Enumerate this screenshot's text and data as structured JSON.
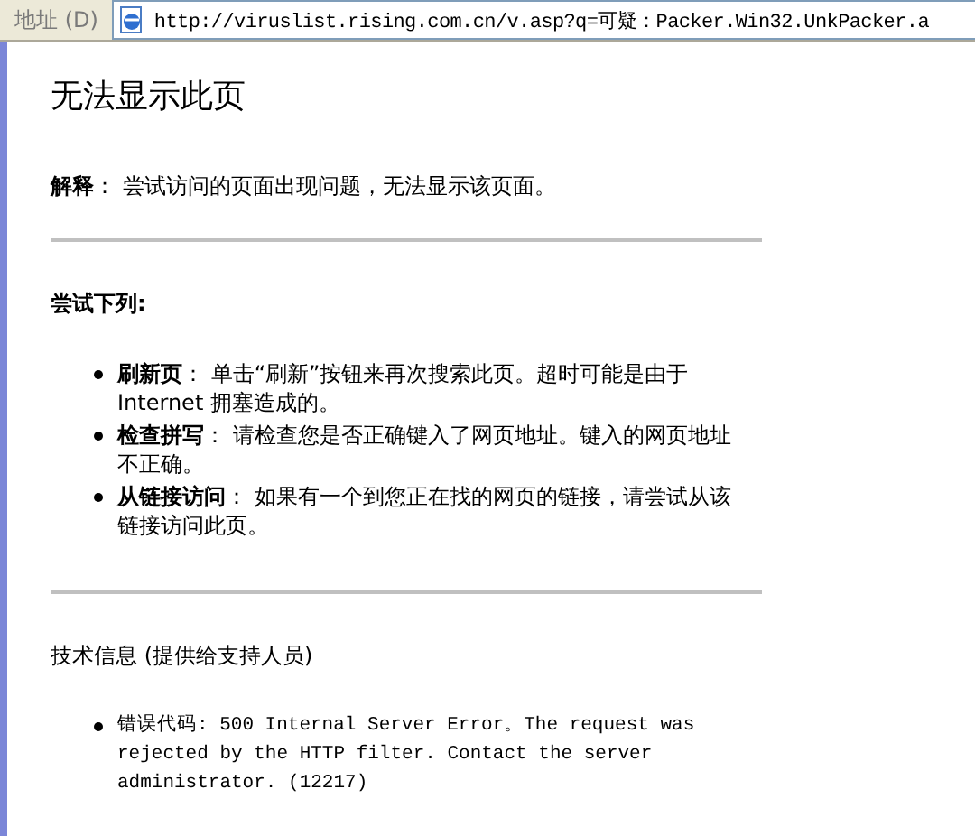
{
  "address_bar": {
    "label": "地址 (D)",
    "url": "http://viruslist.rising.com.cn/v.asp?q=可疑：Packer.Win32.UnkPacker.a"
  },
  "page": {
    "title": "无法显示此页",
    "explanation": "**解释**： 尝试访问的页面出现问题，无法显示该页面。",
    "try_heading": "尝试下列:",
    "suggestions": [
      "**刷新页**： 单击“刷新”按钮来再次搜索此页。超时可能是由于 Internet 拥塞造成的。",
      "**检查拼写**： 请检查您是否正确键入了网页地址。键入的网页地址不正确。",
      "**从链接访问**： 如果有一个到您正在找的网页的链接，请尝试从该链接访问此页。"
    ],
    "tech_heading": "技术信息 (提供给支持人员)",
    "tech_items": [
      "错误代码: 500 Internal Server Error。The request was rejected by the HTTP filter. Contact the server administrator.  (12217)"
    ]
  }
}
